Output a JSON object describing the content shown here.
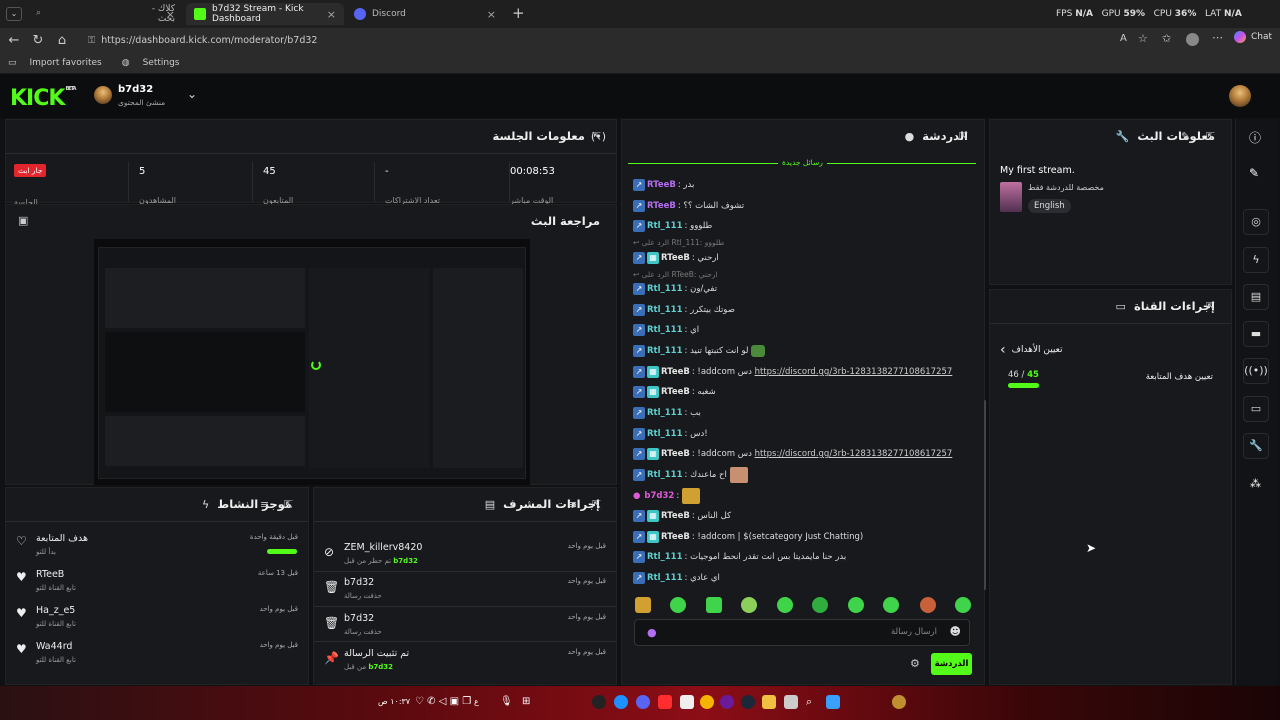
{
  "browser": {
    "tabs": [
      {
        "label": "كلاك - بحث",
        "active": false
      },
      {
        "label": "b7d32 Stream - Kick Dashboard",
        "active": true
      },
      {
        "label": "Discord",
        "active": false
      }
    ],
    "url": "https://dashboard.kick.com/moderator/b7d32",
    "favorites": [
      "Import favorites",
      "Settings"
    ],
    "chat_label": "Chat",
    "perf": {
      "fps_label": "FPS",
      "fps": "N/A",
      "gpu_label": "GPU",
      "gpu": "59%",
      "cpu_label": "CPU",
      "cpu": "36%",
      "lat_label": "LAT",
      "lat": "N/A"
    }
  },
  "header": {
    "logo": "KICK",
    "logo_badge": "BETA",
    "username": "b7d32",
    "role": "منشئ المحتوى"
  },
  "session": {
    "title": "معلومات الجلسة",
    "live_badge": "جار ابث",
    "stats": [
      {
        "value": "00:08:53",
        "label": "الوقت مباشر"
      },
      {
        "value": "-",
        "label": "تعداد الاشتراكات"
      },
      {
        "value": "45",
        "label": "المتابعون"
      },
      {
        "value": "5",
        "label": "المشاهدون"
      },
      {
        "value": "",
        "label": "الجلسة"
      }
    ]
  },
  "preview": {
    "title": "مراجعة البث"
  },
  "chat": {
    "title": "الدردشة",
    "new_messages": "رسائل جديدة",
    "messages": [
      {
        "user": "RTeeB",
        "color": "#b46ef0",
        "text": "بدر",
        "badges": 1
      },
      {
        "user": "RTeeB",
        "color": "#b46ef0",
        "text": "تشوف الشات ؟؟",
        "badges": 1
      },
      {
        "user": "Rtl_111",
        "color": "#5fd0d0",
        "text": "طلووو",
        "badges": 1
      },
      {
        "user": "RTeeB",
        "color": "#e6e6e6",
        "text": "ارحني",
        "badges": 2,
        "reply": "الرد على Rtl_111: طلووو"
      },
      {
        "user": "Rtl_111",
        "color": "#5fd0d0",
        "text": "تفي/ون",
        "badges": 1,
        "reply": "الرد على RTeeB: ارحني"
      },
      {
        "user": "Rtl_111",
        "color": "#5fd0d0",
        "text": "صوتك بيتكرر",
        "badges": 1
      },
      {
        "user": "Rtl_111",
        "color": "#5fd0d0",
        "text": "اي",
        "badges": 1
      },
      {
        "user": "Rtl_111",
        "color": "#5fd0d0",
        "text": "لو انت كتبتها تنيد",
        "badges": 1
      },
      {
        "user": "RTeeB",
        "color": "#e6e6e6",
        "text": "!addcom دس",
        "link": "https://discord.gg/3rb-1283138277108617257",
        "badges": 2
      },
      {
        "user": "RTeeB",
        "color": "#e6e6e6",
        "text": "شغبه",
        "badges": 2
      },
      {
        "user": "Rtl_111",
        "color": "#5fd0d0",
        "text": "بب",
        "badges": 1
      },
      {
        "user": "Rtl_111",
        "color": "#5fd0d0",
        "text": "دس!",
        "badges": 1
      },
      {
        "user": "RTeeB",
        "color": "#e6e6e6",
        "text": "!addcom دس",
        "link": "https://discord.gg/3rb-1283138277108617257",
        "badges": 2
      },
      {
        "user": "Rtl_111",
        "color": "#5fd0d0",
        "text": "اح ماعندك",
        "badges": 1
      },
      {
        "user": "b7d32",
        "color": "#e05ad8",
        "text": "",
        "badges": 0
      },
      {
        "user": "RTeeB",
        "color": "#e6e6e6",
        "text": "كل الناس",
        "badges": 2
      },
      {
        "user": "RTeeB",
        "color": "#e6e6e6",
        "text": "!addcom | $(setcategory Just Chatting)",
        "badges": 2
      },
      {
        "user": "Rtl_111",
        "color": "#5fd0d0",
        "text": "بدر حنا مايمديتا بس انت تقدر انحط اموجيات",
        "badges": 1
      },
      {
        "user": "Rtl_111",
        "color": "#5fd0d0",
        "text": "اي عادي",
        "badges": 1
      }
    ],
    "input_placeholder": "ارسال رسالة",
    "send_label": "الدردشة"
  },
  "stream_info": {
    "title": "معلومات البث",
    "stream_title": "My first stream.",
    "category": "مخصصة للدردشة فقط",
    "language": "English"
  },
  "channel_actions": {
    "title": "إجراءات القناة",
    "back_label": "تعيين الأهداف",
    "goal_label": "تعيين هدف المتابعة",
    "goal_current": "45",
    "goal_target": "46",
    "goal_fraction": 0.978
  },
  "activity": {
    "title": "موجز النشاط",
    "items": [
      {
        "name": "هدف المتابعة",
        "sub": "بدأ للتو",
        "time": "قبل دقيقة واحدة",
        "progress": 0.98
      },
      {
        "name": "RTeeB",
        "sub": "تابع القناة للتو",
        "time": "قبل 13 ساعة"
      },
      {
        "name": "Ha_z_e5",
        "sub": "تابع القناة للتو",
        "time": "قبل يوم واحد"
      },
      {
        "name": "Wa44rd",
        "sub": "تابع القناة للتو",
        "time": "قبل يوم واحد"
      }
    ]
  },
  "mod_actions": {
    "title": "إجراءات المشرف",
    "items": [
      {
        "name": "ZEM_killerv8420",
        "sub": "تم حظر من قبل",
        "by": "b7d32",
        "time": "قبل يوم واحد",
        "icon": "ban-icon"
      },
      {
        "name": "b7d32",
        "sub": "حذفت رسالة",
        "by": "",
        "time": "قبل يوم واحد",
        "icon": "trash-icon"
      },
      {
        "name": "b7d32",
        "sub": "حذفت رسالة",
        "by": "",
        "time": "قبل يوم واحد",
        "icon": "trash-icon"
      },
      {
        "name": "تم تثبيت الرسالة",
        "sub": "من قبل",
        "by": "b7d32",
        "time": "قبل يوم واحد",
        "icon": "pin-icon"
      }
    ]
  },
  "taskbar": {
    "clock": "١٠:٣٧ ص",
    "lang": "ع"
  },
  "colors": {
    "accent": "#53fc18",
    "live": "#e3262e",
    "bg": "#101114",
    "panel": "#18191d"
  }
}
